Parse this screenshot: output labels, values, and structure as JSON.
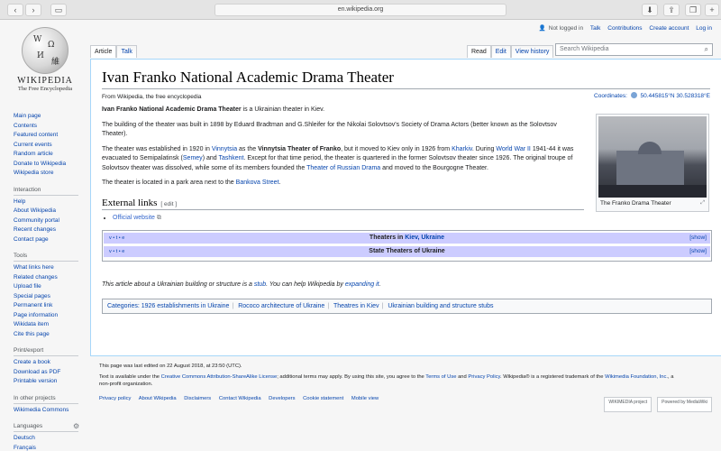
{
  "browser": {
    "url": "en.wikipedia.org",
    "back": "‹",
    "forward": "›",
    "sidebar_btn": "▭",
    "share": "⇪",
    "tabs_btn": "❐",
    "download": "⬇",
    "newtab": "+"
  },
  "logo": {
    "wordmark": "WIKIPEDIA",
    "tagline": "The Free Encyclopedia"
  },
  "personal": {
    "not_logged_in": "Not logged in",
    "talk": "Talk",
    "contributions": "Contributions",
    "create_account": "Create account",
    "log_in": "Log in"
  },
  "tabs": {
    "article": "Article",
    "talk": "Talk",
    "read": "Read",
    "edit": "Edit",
    "history": "View history"
  },
  "search": {
    "placeholder": "Search Wikipedia"
  },
  "sidebar": {
    "nav": [
      "Main page",
      "Contents",
      "Featured content",
      "Current events",
      "Random article",
      "Donate to Wikipedia",
      "Wikipedia store"
    ],
    "interaction_title": "Interaction",
    "interaction": [
      "Help",
      "About Wikipedia",
      "Community portal",
      "Recent changes",
      "Contact page"
    ],
    "tools_title": "Tools",
    "tools": [
      "What links here",
      "Related changes",
      "Upload file",
      "Special pages",
      "Permanent link",
      "Page information",
      "Wikidata item",
      "Cite this page"
    ],
    "print_title": "Print/export",
    "print": [
      "Create a book",
      "Download as PDF",
      "Printable version"
    ],
    "other_title": "In other projects",
    "other": [
      "Wikimedia Commons"
    ],
    "lang_title": "Languages",
    "langs": [
      "Deutsch",
      "Français"
    ]
  },
  "article": {
    "title": "Ivan Franko National Academic Drama Theater",
    "from": "From Wikipedia, the free encyclopedia",
    "coords_label": "Coordinates:",
    "coords_value": "50.445815°N 30.528318°E",
    "p1_bold": "Ivan Franko National Academic Drama Theater",
    "p1_rest": " is a Ukrainian theater in Kiev.",
    "p2": "The building of the theater was built in 1898 by Eduard Bradtman and G.Shleifer for the Nikolai Solovtsov's Society of Drama Actors (better known as the Solovtsov Theater).",
    "p3": {
      "a": "The theater was established in 1920 in ",
      "vinnytsia": "Vinnytsia",
      "b": " as the ",
      "bold": "Vinnytsia Theater of Franko",
      "c": ", but it moved to Kiev only in 1926 from ",
      "kharkiv": "Kharkiv",
      "d": ". During ",
      "ww2": "World War II",
      "e": " 1941-44 it was evacuated to Semipalatinsk (",
      "semey": "Semey",
      "f": ") and ",
      "tashkent": "Tashkent",
      "g": ". Except for that time period, the theater is quartered in the former Solovtsov theater since 1926. The original troupe of Solovtsov theater was dissolved, while some of its members founded the ",
      "russian_drama": "Theater of Russian Drama",
      "h": " and moved to the Bourgogne Theater."
    },
    "p4_a": "The theater is located in a park area next to the ",
    "p4_link": "Bankova Street",
    "p4_b": ".",
    "caption": "The Franko Drama Theater",
    "ext_heading": "External links",
    "edit_label": "[ edit ]",
    "official": "Official website",
    "navbox1_a": "Theaters in ",
    "navbox1_link": "Kiev, Ukraine",
    "navbox2": "State Theaters of Ukraine",
    "vte": "v • t • e",
    "show": "[show]",
    "stub_a": "This article about a Ukrainian building or structure is a ",
    "stub_link": "stub",
    "stub_b": ". You can help Wikipedia by ",
    "stub_link2": "expanding it",
    "stub_c": ".",
    "categories_label": "Categories:",
    "categories": [
      "1926 establishments in Ukraine",
      "Rococo architecture of Ukraine",
      "Theatres in Kiev",
      "Ukrainian building and structure stubs"
    ]
  },
  "footer": {
    "last_edited": "This page was last edited on 22 August 2018, at 23:50 (UTC).",
    "license_a": "Text is available under the ",
    "license_link": "Creative Commons Attribution-ShareAlike License",
    "license_b": "; additional terms may apply. By using this site, you agree to the ",
    "terms": "Terms of Use",
    "license_c": " and ",
    "privacy": "Privacy Policy",
    "license_d": ". Wikipedia® is a registered trademark of the ",
    "wmf": "Wikimedia Foundation, Inc.",
    "license_e": ", a non-profit organization.",
    "links": [
      "Privacy policy",
      "About Wikipedia",
      "Disclaimers",
      "Contact Wikipedia",
      "Developers",
      "Cookie statement",
      "Mobile view"
    ],
    "badge1": "WIKIMEDIA project",
    "badge2": "Powered by MediaWiki"
  }
}
